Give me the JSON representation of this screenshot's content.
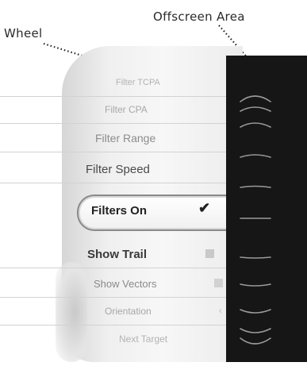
{
  "annotations": {
    "wheel": "Wheel",
    "offscreen": "Offscreen Area"
  },
  "wheel": {
    "items": [
      {
        "label": "Filter TCPA",
        "style": "faded"
      },
      {
        "label": "Filter CPA",
        "style": "faded"
      },
      {
        "label": "Filter Range",
        "style": "normal"
      },
      {
        "label": "Filter Speed",
        "style": "normal"
      },
      {
        "label": "Filters On",
        "style": "selected",
        "checked": true
      },
      {
        "label": "Show Trail",
        "style": "normal",
        "checked": false
      },
      {
        "label": "Show Vectors",
        "style": "faded",
        "checked": false
      },
      {
        "label": "Orientation",
        "style": "faded"
      },
      {
        "label": "Next Target",
        "style": "faded"
      }
    ]
  },
  "offscreen_area": {
    "background": "#161616",
    "tick_color": "#9a9a9a"
  }
}
